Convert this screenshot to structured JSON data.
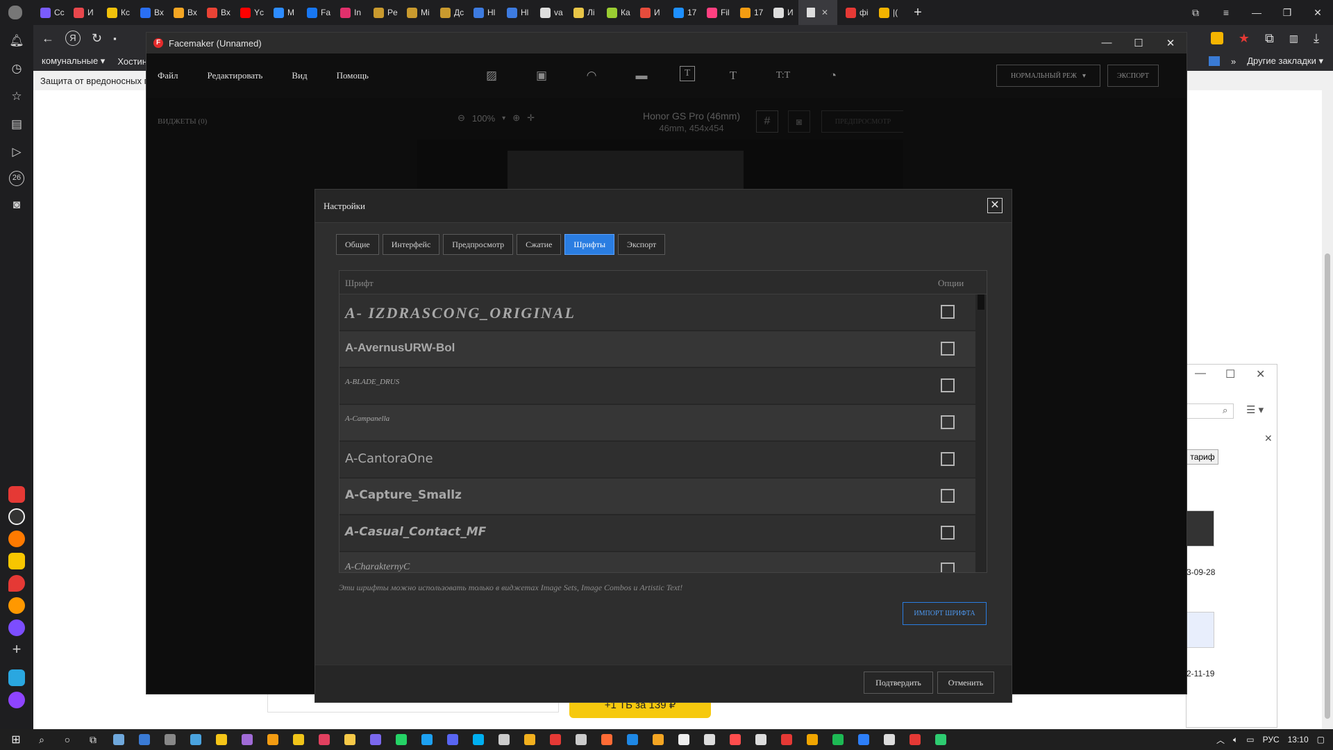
{
  "browser": {
    "tabs": [
      {
        "label": "Cc",
        "color": "#7a5cff"
      },
      {
        "label": "И",
        "color": "#e8474c"
      },
      {
        "label": "Кс",
        "color": "#f2c20b"
      },
      {
        "label": "Вх",
        "color": "#2a6ff3"
      },
      {
        "label": "Вх",
        "color": "#f5a623"
      },
      {
        "label": "Вх",
        "color": "#ea4335"
      },
      {
        "label": "Yc",
        "color": "#ff0000"
      },
      {
        "label": "M",
        "color": "#2d8cff"
      },
      {
        "label": "Fa",
        "color": "#1877f2"
      },
      {
        "label": "In",
        "color": "#e1306c"
      },
      {
        "label": "Pe",
        "color": "#c99a2e"
      },
      {
        "label": "Mi",
        "color": "#c99a2e"
      },
      {
        "label": "Дс",
        "color": "#c99a2e"
      },
      {
        "label": "Hl",
        "color": "#3d7be0"
      },
      {
        "label": "Hl",
        "color": "#3d7be0"
      },
      {
        "label": "va",
        "color": "#dddddd"
      },
      {
        "label": "Лі",
        "color": "#e8c547"
      },
      {
        "label": "Ка",
        "color": "#9acd32"
      },
      {
        "label": "И",
        "color": "#e74c3c"
      },
      {
        "label": "17",
        "color": "#1e90ff"
      },
      {
        "label": "Fil",
        "color": "#ff4081"
      },
      {
        "label": "17",
        "color": "#f39c12"
      },
      {
        "label": "И",
        "color": "#dddddd"
      }
    ],
    "active_tab": {
      "label": "",
      "color": "#dddddd"
    },
    "extra_tabs": [
      {
        "label": "фі",
        "color": "#e53935"
      },
      {
        "label": "|(",
        "color": "#f4b400"
      }
    ],
    "new_tab": "+",
    "bookmarks": [
      {
        "label": "комунальные"
      },
      {
        "label": "Хостин"
      }
    ],
    "bookmarks_right": "Другие закладки",
    "warning": "Защита от вредоносных п",
    "left_badge": "26",
    "promo": "+1 ТБ за 139 ₽"
  },
  "file_explorer": {
    "button": "тариф",
    "date1": "3-09-28",
    "date2": "2-11-19"
  },
  "facemaker": {
    "title": "Facemaker (Unnamed)",
    "logo": "F",
    "menu": [
      "Файл",
      "Редактировать",
      "Вид",
      "Помощь"
    ],
    "tools": [
      "▨",
      "▣",
      "◠",
      "▬",
      "T",
      "T",
      "T:T",
      "◔"
    ],
    "mode": "НОРМАЛЬНЫЙ РЕЖ",
    "export": "ЭКСПОРТ",
    "widgets": "ВИДЖЕТЫ  (0)",
    "zoom": "100%",
    "device": "Honor GS Pro (46mm)",
    "device_sub": "46mm, 454x454",
    "preview": "ПРЕДПРОСМОТР"
  },
  "dialog": {
    "title": "Настройки",
    "tabs": [
      "Общие",
      "Интерфейс",
      "Предпросмотр",
      "Сжатие",
      "Шрифты",
      "Экспорт"
    ],
    "active_tab": "Шрифты",
    "col_font": "Шрифт",
    "col_options": "Опции",
    "fonts": [
      {
        "name": "A- IZDRASCONG_ORIGINAL",
        "style": "italic",
        "weight": "bold",
        "size": 22,
        "family": "Liberation Serif",
        "spacing": 2
      },
      {
        "name": "A-AvernusURW-Bol",
        "style": "normal",
        "weight": "bold",
        "size": 17,
        "family": "Liberation Sans",
        "spacing": 0
      },
      {
        "name": "A-BLADE_DRUS",
        "style": "italic",
        "weight": "normal",
        "size": 11,
        "family": "Liberation Serif",
        "spacing": 0
      },
      {
        "name": "A-Campanella",
        "style": "italic",
        "weight": "normal",
        "size": 11,
        "family": "Liberation Serif",
        "spacing": 0
      },
      {
        "name": "A-CantoraOne",
        "style": "normal",
        "weight": "normal",
        "size": 18,
        "family": "DejaVu Sans",
        "spacing": 0
      },
      {
        "name": "A-Capture_Smallz",
        "style": "normal",
        "weight": "bold",
        "size": 17,
        "family": "DejaVu Sans",
        "spacing": 0
      },
      {
        "name": "A-Casual_Contact_MF",
        "style": "italic",
        "weight": "bold",
        "size": 17,
        "family": "DejaVu Sans",
        "spacing": 0
      },
      {
        "name": "A-CharakternyC",
        "style": "italic",
        "weight": "normal",
        "size": 14,
        "family": "Liberation Serif",
        "spacing": 0
      }
    ],
    "note": "Эти шрифты можно использовать только в виджетах Image Sets, Image Combos и Artistic Text!",
    "import": "ИМПОРТ ШРИФТА",
    "confirm": "Подтвердить",
    "cancel": "Отменить"
  },
  "taskbar": {
    "icons": [
      "#6fa8dc",
      "#3a7bd5",
      "#888888",
      "#4aa3df",
      "#f5c518",
      "#a06bd6",
      "#f39c12",
      "#f0c419",
      "#e2405f",
      "#f7c948",
      "#7b68ee",
      "#25d366",
      "#1da1f2",
      "#5865f2",
      "#00aff0",
      "#cccccc",
      "#f2b01e",
      "#e53935",
      "#cccccc",
      "#ff6b35",
      "#1e88e5",
      "#f5a623",
      "#eeeeee",
      "#dddddd",
      "#ff4d4d",
      "#dddddd",
      "#e53935",
      "#f0a500",
      "#1db954",
      "#2d7ff9",
      "#dddddd",
      "#e53935",
      "#2ecc71"
    ],
    "lang": "РУС",
    "time": "13:10"
  }
}
